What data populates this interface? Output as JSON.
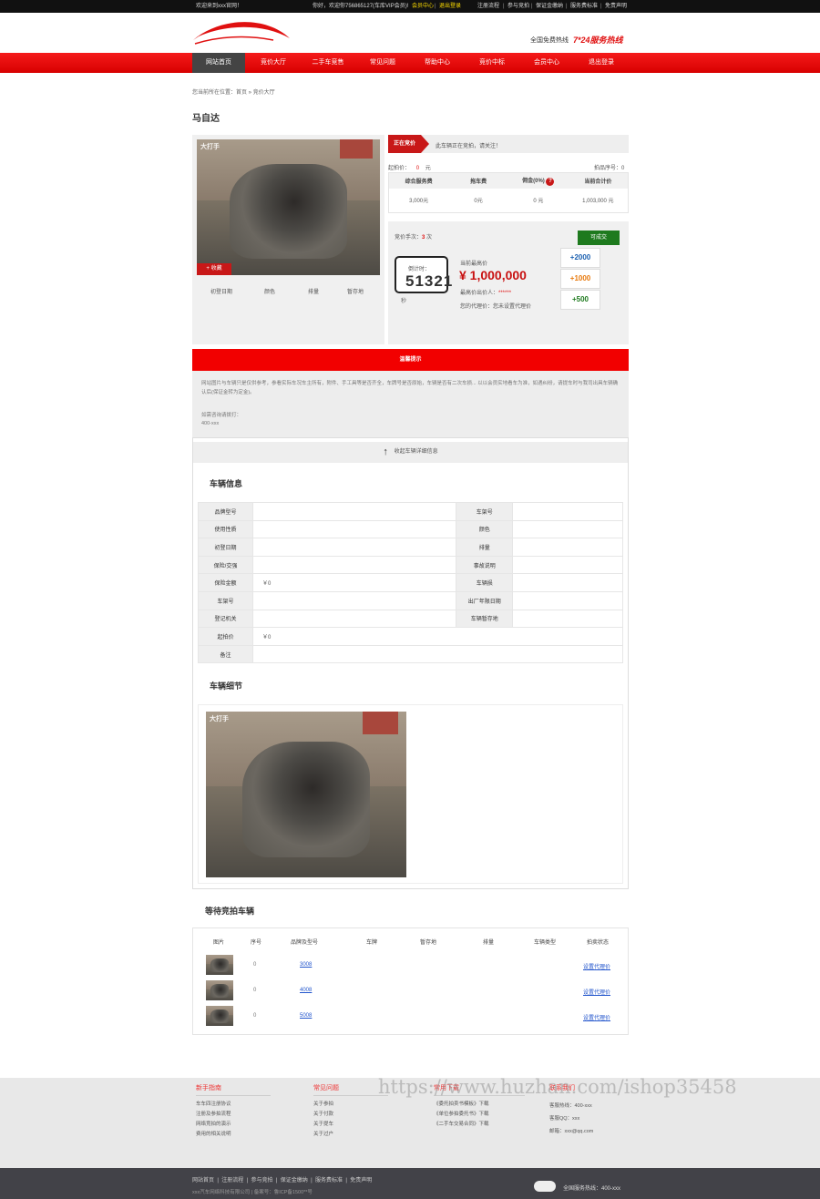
{
  "topbar": {
    "welcome": "欢迎来到xxx官网！",
    "greeting": "你好，欢迎你756865127(车库VIP会员)!",
    "member_center": "会员中心",
    "logout": "退出登录",
    "links": [
      "注册流程",
      "参与竞拍",
      "保证金缴纳",
      "服务费标准",
      "免责声明"
    ]
  },
  "header": {
    "hotline_label": "全国免费热线",
    "hotline_value": "7*24服务热线"
  },
  "nav": {
    "items": [
      "网站首页",
      "竞价大厅",
      "二手车竞售",
      "常见问题",
      "帮助中心",
      "竞价中标",
      "会员中心",
      "退出登录"
    ],
    "active_index": 0
  },
  "breadcrumb": "您当前所在位置：首页 » 竞价大厅",
  "title": "马自达",
  "gallery": {
    "watermark": "大打手",
    "favorite": "+ 收藏",
    "tabs": [
      "初登日期",
      "颜色",
      "排量",
      "暂存地"
    ]
  },
  "auction": {
    "status": "正在竞价",
    "status_msg": "此车辆正在竞拍，请关注！",
    "start_price_label": "起拍价：",
    "start_price_value": "0",
    "start_price_unit": "元",
    "lot_label": "拍品序号：",
    "lot_value": "0",
    "fee_headers": [
      "综合服务费",
      "拖车费",
      "佣金(0%)",
      "当前合计价"
    ],
    "fee_values": [
      "3,000元",
      "0元",
      "0 元",
      "1,003,000 元"
    ],
    "bid_count_label": "竞价手次：",
    "bid_count_value": "3",
    "bid_count_unit": "次",
    "deal_button": "可成交",
    "countdown_label": "倒计时：",
    "countdown_value": "51321",
    "countdown_unit": "秒",
    "current_label": "当前最高价",
    "current_value": "¥ 1,000,000",
    "top_bidder_label": "最高价出价人：",
    "top_bidder_value": "******",
    "proxy_label": "您的代理价：您未设置代理价",
    "bid_buttons": [
      "+2000",
      "+1000",
      "+500"
    ]
  },
  "notice": {
    "title": "温馨提示",
    "text": "网站图片与车辆只是仅供参考，参看实际车况车主所有，附件、手工具等是否齐全，车牌号是否原始，车辆是否有二次车损... 以以会员实地看车为准，如遇纠纷，请提车时与我司出具车辆确认后(保证金转为定金)。",
    "contact_label": "如需咨询请拨打：",
    "contact_value": "400-xxx"
  },
  "toggle": "收起车辆详细信息",
  "vehicle_info": {
    "title": "车辆信息",
    "rows": [
      [
        "品牌型号",
        "",
        "车架号",
        ""
      ],
      [
        "使用性质",
        "",
        "颜色",
        ""
      ],
      [
        "初登日期",
        "",
        "排量",
        ""
      ],
      [
        "保险/交强",
        "",
        "事故说明",
        ""
      ],
      [
        "保险金额",
        "￥0",
        "车辆损",
        ""
      ],
      [
        "车架号",
        "",
        "出厂年限日期",
        ""
      ],
      [
        "登记机关",
        "",
        "车辆暂存地",
        ""
      ],
      [
        "起拍价",
        "￥0",
        "",
        ""
      ],
      [
        "备注",
        "",
        "",
        ""
      ]
    ]
  },
  "details": {
    "title": "车辆细节",
    "watermark": "大打手"
  },
  "waiting": {
    "title": "等待竞拍车辆",
    "headers": [
      "图片",
      "序号",
      "品牌及型号",
      "车牌",
      "暂存地",
      "排量",
      "车辆类型",
      "拍卖状态"
    ],
    "rows": [
      {
        "no": "0",
        "model": "3008",
        "status": "设置代理价"
      },
      {
        "no": "0",
        "model": "4008",
        "status": "设置代理价"
      },
      {
        "no": "0",
        "model": "5008",
        "status": "设置代理价"
      }
    ]
  },
  "footer": {
    "cols": [
      {
        "title": "新手指南",
        "links": [
          "车车四注册协议",
          "注册及参拍流程",
          "网络竞拍的演示",
          "费用的相关说明"
        ]
      },
      {
        "title": "常见问题",
        "links": [
          "关于参拍",
          "关于付款",
          "关于提车",
          "关于过户"
        ]
      },
      {
        "title": "常用下载",
        "links": [
          "《委托拍卖书模板》下载",
          "《单位参拍委托书》下载",
          "《二手车交易合同》下载"
        ]
      },
      {
        "title": "联系我们",
        "links": [
          "客服热线：400-xxx",
          "客服QQ：xxx",
          "邮箱：xxx@qq.com"
        ]
      }
    ],
    "watermark": "https://www.huzhan.com/ishop35458",
    "bottom_links": [
      "网站首页",
      "注册流程",
      "参与竞拍",
      "保证金缴纳",
      "服务费标准",
      "免责声明"
    ],
    "copyright": "xxx汽车网络科技有限公司 | 备案号：鲁ICP备1500**号",
    "hotline": "全国服务热线：400-xxx"
  }
}
